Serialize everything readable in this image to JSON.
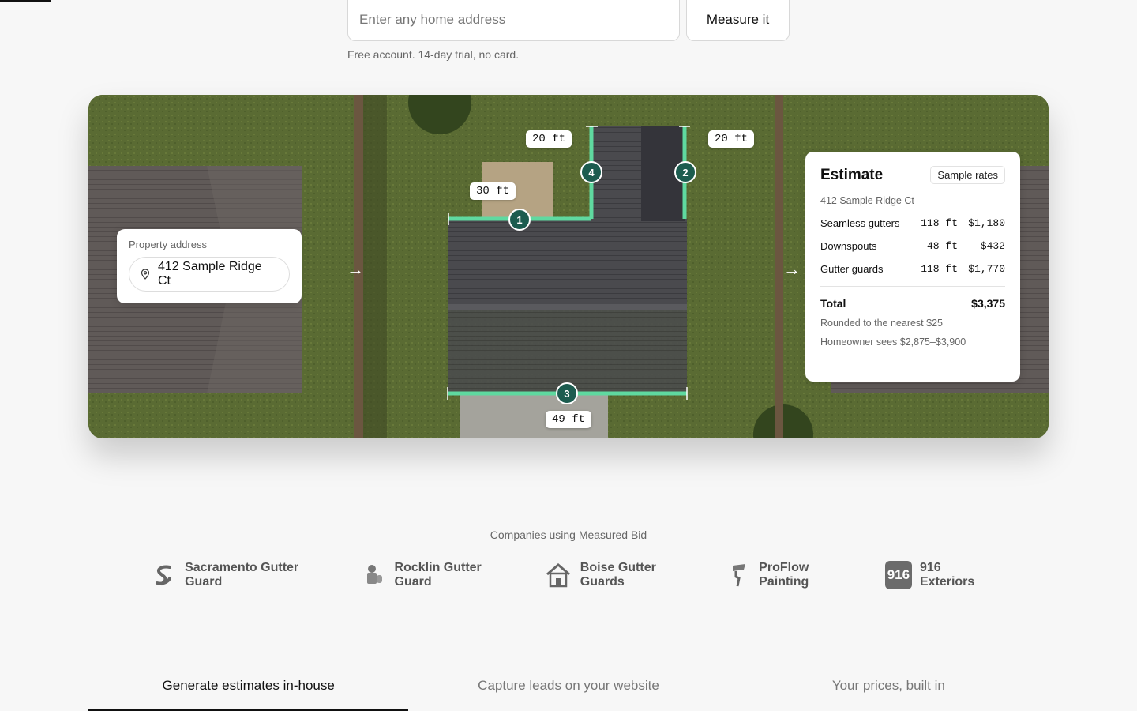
{
  "form": {
    "address_placeholder": "Enter any home address",
    "measure_button": "Measure it",
    "trial_note": "Free account. 14-day trial, no card."
  },
  "hero": {
    "property_card": {
      "label": "Property address",
      "address": "412 Sample Ridge Ct"
    },
    "arrow_glyph": "→",
    "measurements": [
      {
        "id": "1",
        "label": "30 ft"
      },
      {
        "id": "2",
        "label": "20 ft"
      },
      {
        "id": "3",
        "label": "49 ft"
      },
      {
        "id": "4",
        "label": "20 ft"
      }
    ],
    "estimate": {
      "title": "Estimate",
      "badge": "Sample rates",
      "address": "412 Sample Ridge Ct",
      "rows": [
        {
          "name": "Seamless gutters",
          "qty": "118 ft",
          "cost": "$1,180"
        },
        {
          "name": "Downspouts",
          "qty": "48 ft",
          "cost": "$432"
        },
        {
          "name": "Gutter guards",
          "qty": "118 ft",
          "cost": "$1,770"
        }
      ],
      "total_label": "Total",
      "total_value": "$3,375",
      "rounding_note": "Rounded to the nearest $25",
      "homeowner_note": "Homeowner sees $2,875–$3,900"
    },
    "colors": {
      "measure_line": "#5fd9a0",
      "marker": "#1c5c4f"
    }
  },
  "companies": {
    "title": "Companies using Measured Bid",
    "logos": [
      {
        "name": "Sacramento Gutter Guard",
        "icon": "s-swoosh-icon"
      },
      {
        "name": "Rocklin Gutter Guard",
        "icon": "knight-icon"
      },
      {
        "name": "Boise Gutter Guards",
        "icon": "house-icon"
      },
      {
        "name": "ProFlow Painting",
        "icon": "paint-roller-icon"
      },
      {
        "name": "916 Exteriors",
        "icon": "916-badge-icon",
        "badge_text": "916"
      }
    ]
  },
  "tabs": [
    {
      "label": "Generate estimates in-house",
      "active": true
    },
    {
      "label": "Capture leads on your website",
      "active": false
    },
    {
      "label": "Your prices, built in",
      "active": false
    }
  ]
}
